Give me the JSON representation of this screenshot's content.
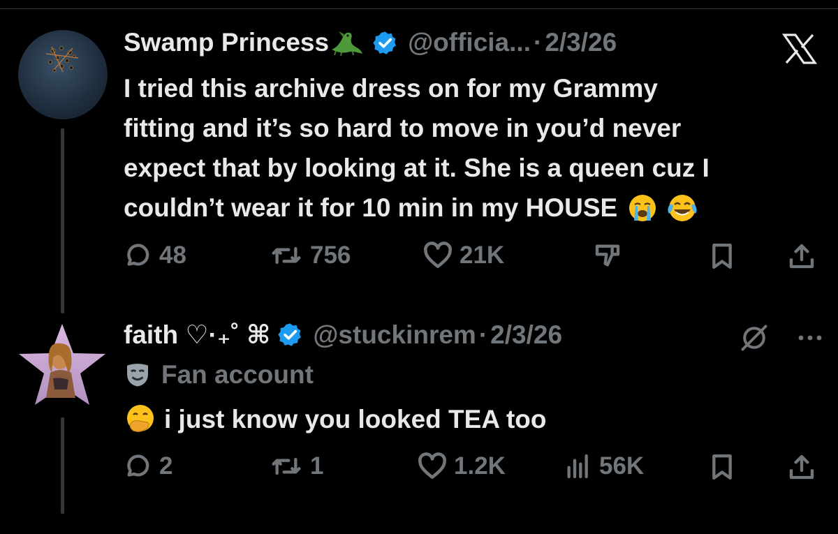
{
  "tweet1": {
    "display_name": "Swamp Princess",
    "name_emoji": "crocodile-emoji",
    "handle": "@officia...",
    "separator": "·",
    "date": "2/3/26",
    "body_lines": [
      "I tried this archive dress on for my Grammy",
      "fitting and it’s so hard to move in you’d never",
      "expect that by looking at it. She is a queen cuz I",
      "couldn’t wear it for 10 min in my HOUSE"
    ],
    "body_trailing_emojis": [
      "loudly-crying-face-emoji",
      "face-with-tears-of-joy-emoji"
    ],
    "replies": "48",
    "reposts": "756",
    "likes": "21K"
  },
  "tweet2": {
    "display_name": "faith ♡·₊˚ ⌘",
    "handle": "@stuckinrem",
    "separator": "·",
    "date": "2/3/26",
    "label": "Fan account",
    "label_icon": "performing-arts-mask-emoji",
    "body": "i just know you looked TEA too",
    "body_leading_emoji": "face-with-hand-over-mouth-emoji",
    "replies": "2",
    "reposts": "1",
    "likes": "1.2K",
    "views": "56K"
  },
  "colors": {
    "background": "#000000",
    "primary_text": "#e7e9ea",
    "secondary_text": "#71767b",
    "verified_blue": "#1d9bf0"
  }
}
